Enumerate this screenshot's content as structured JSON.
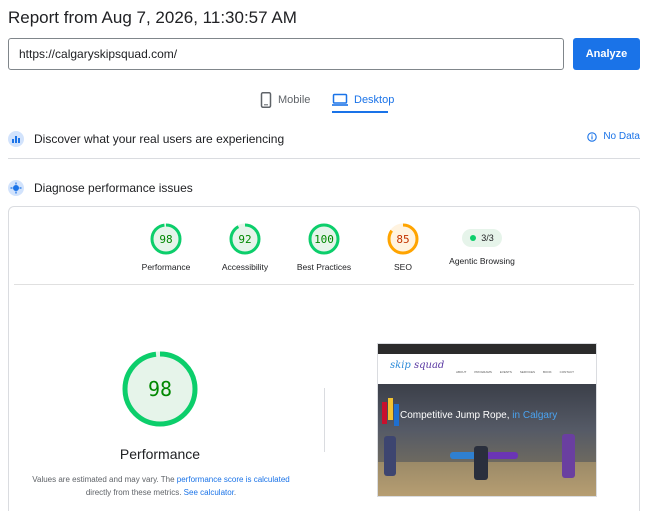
{
  "header": {
    "title": "Report from Aug 7, 2026, 11:30:57 AM"
  },
  "search": {
    "url": "https://calgaryskipsquad.com/",
    "analyze_label": "Analyze"
  },
  "tabs": [
    {
      "label": "Mobile",
      "active": false
    },
    {
      "label": "Desktop",
      "active": true
    }
  ],
  "real_users": {
    "label": "Discover what your real users are experiencing",
    "status": "No Data"
  },
  "diagnose": {
    "label": "Diagnose performance issues"
  },
  "scores": [
    {
      "value": "98",
      "label": "Performance",
      "color": "#0cce6b"
    },
    {
      "value": "92",
      "label": "Accessibility",
      "color": "#0cce6b"
    },
    {
      "value": "100",
      "label": "Best Practices",
      "color": "#0cce6b"
    },
    {
      "value": "85",
      "label": "SEO",
      "color": "#ffa400"
    }
  ],
  "agentic": {
    "value": "3/3",
    "label": "Agentic Browsing"
  },
  "main_score": {
    "value": "98",
    "label": "Performance"
  },
  "footnote": {
    "prefix": "Values are estimated and may vary. The ",
    "link1": "performance score is calculated",
    "middle": " directly from these metrics. ",
    "link2": "See calculator",
    "suffix": "."
  },
  "screenshot": {
    "logo_skip": "skip",
    "logo_squad": " squad",
    "menu": [
      "ABOUT",
      "PROGRAMS",
      "EVENTS",
      "SERVICES",
      "BOOK",
      "CONTACT"
    ],
    "headline_main": "Competitive Jump Rope, ",
    "headline_accent": "in Calgary"
  },
  "colors": {
    "accent": "#1a73e8",
    "pass": "#0cce6b",
    "average": "#ffa400"
  }
}
